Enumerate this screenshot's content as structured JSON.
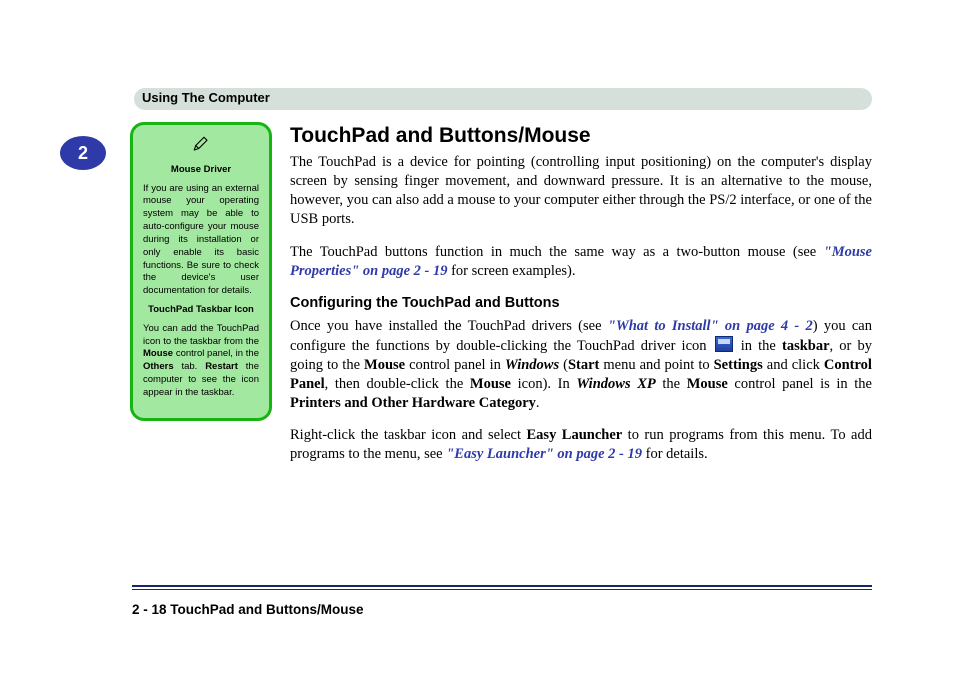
{
  "chapter": {
    "number": "2",
    "title": "Using The Computer"
  },
  "sidebar": {
    "title1": "Mouse Driver",
    "para1": "If you are using an external mouse your operating system may be able to auto-configure your mouse during its installation or only enable its basic functions. Be sure to check the device's user documentation for details.",
    "title2": "TouchPad Taskbar Icon",
    "para2a": "You can add the TouchPad icon to the taskbar from the ",
    "para2b": "Mouse",
    "para2c": " control panel, in the ",
    "para2d": "Others",
    "para2e": " tab. ",
    "para2f": "Restart",
    "para2g": " the computer to see the icon appear in the taskbar."
  },
  "main": {
    "h1": "TouchPad and Buttons/Mouse",
    "p1": "The TouchPad is a device for pointing (controlling input positioning) on the computer's display screen by sensing finger movement, and downward pressure. It is an alternative to the mouse, however, you can also add a mouse to your computer either through the PS/2 interface, or one of the USB ports.",
    "p2a": "The TouchPad buttons function in much the same way as a two-button mouse (see ",
    "p2link": "\"Mouse Properties\" on page 2 - 19",
    "p2b": " for screen examples).",
    "h2": "Configuring the TouchPad and Buttons",
    "p3a": "Once you have installed the TouchPad drivers (see ",
    "p3link": "\"What to Install\" on page 4 - 2",
    "p3b": ") you can configure the functions by double-clicking the TouchPad driver icon ",
    "p3c": " in the ",
    "p3d": "taskbar",
    "p3e": ", or by going to the ",
    "p3f": "Mouse",
    "p3g": " control panel in ",
    "p3h": "Windows",
    "p3i": " (",
    "p3j": "Start",
    "p3k": " menu and point to ",
    "p3l": "Settings",
    "p3m": " and click ",
    "p3n": "Control Panel",
    "p3o": ", then double-click the ",
    "p3p": "Mouse",
    "p3q": " icon). In ",
    "p3r": "Windows XP",
    "p3s": " the ",
    "p3t": "Mouse",
    "p3u": " control panel is in the ",
    "p3v": "Printers and Other Hardware Category",
    "p3w": ".",
    "p4a": "Right-click the taskbar icon and select ",
    "p4b": "Easy Launcher",
    "p4c": " to run programs from this menu. To add programs to the menu, see ",
    "p4link": "\"Easy Launcher\" on page 2 - 19",
    "p4d": " for details."
  },
  "footer": {
    "text": "2 - 18  TouchPad and Buttons/Mouse"
  }
}
